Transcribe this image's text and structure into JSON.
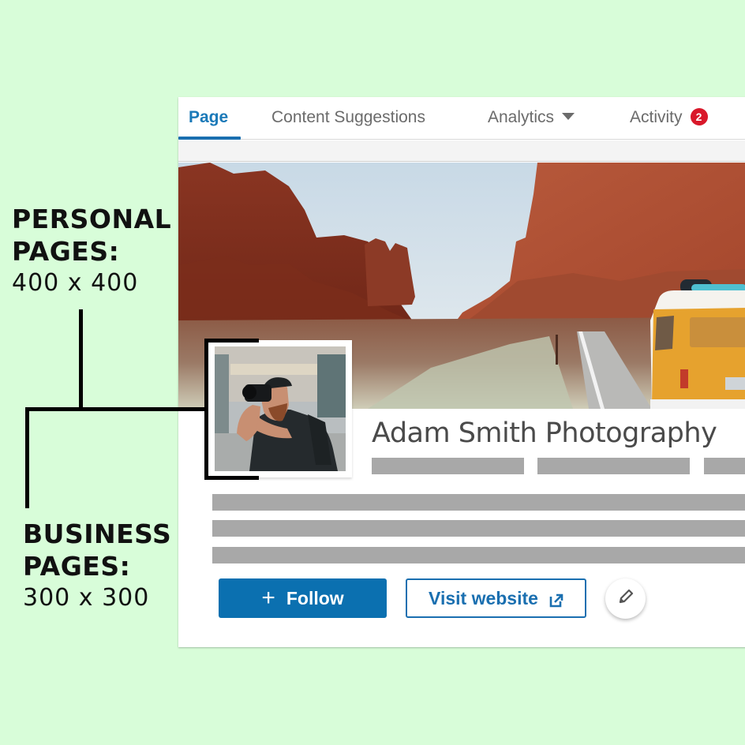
{
  "annotations": {
    "personal": {
      "heading_line1": "PERSONAL",
      "heading_line2": "PAGES:",
      "size": "400 x 400"
    },
    "business": {
      "heading_line1": "BUSINESS",
      "heading_line2": "PAGES:",
      "size": "300 x 300"
    }
  },
  "tabs": [
    {
      "label": "Page",
      "active": true
    },
    {
      "label": "Content Suggestions",
      "active": false
    },
    {
      "label": "Analytics",
      "active": false,
      "icon": "caret-down-icon"
    },
    {
      "label": "Activity",
      "active": false,
      "badge": "2"
    }
  ],
  "profile": {
    "name": "Adam Smith Photography",
    "cover_description": "Red rock canyon road with yellow camper van",
    "photo_description": "Bearded photographer holding a camera in a city street"
  },
  "actions": {
    "follow_label": "Follow",
    "follow_icon": "plus-icon",
    "visit_label": "Visit website",
    "visit_icon": "external-link-icon",
    "edit_icon": "pencil-icon"
  },
  "colors": {
    "background": "#d8fdd9",
    "accent": "#0b70b0",
    "badge": "#d9182a",
    "placeholder_bar": "#a8a8a8",
    "name_text": "#4a4a4a"
  }
}
